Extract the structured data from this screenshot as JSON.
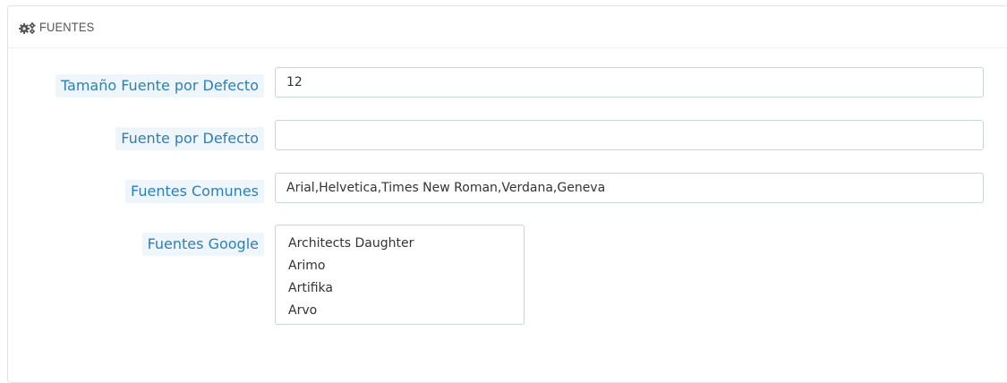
{
  "panel": {
    "title": "FUENTES",
    "icon": "gears-icon"
  },
  "fields": {
    "default_size": {
      "label": "Tamaño Fuente por Defecto",
      "value": "12"
    },
    "default_font": {
      "label": "Fuente por Defecto",
      "value": ""
    },
    "common_fonts": {
      "label": "Fuentes Comunes",
      "value": "Arial,Helvetica,Times New Roman,Verdana,Geneva"
    },
    "google_fonts": {
      "label": "Fuentes Google",
      "options": [
        "Architects Daughter",
        "Arimo",
        "Artifika",
        "Arvo"
      ]
    }
  },
  "colors": {
    "label_text": "#2e7fb6",
    "label_bg": "#eef6fb",
    "input_border": "#c7d6db"
  }
}
